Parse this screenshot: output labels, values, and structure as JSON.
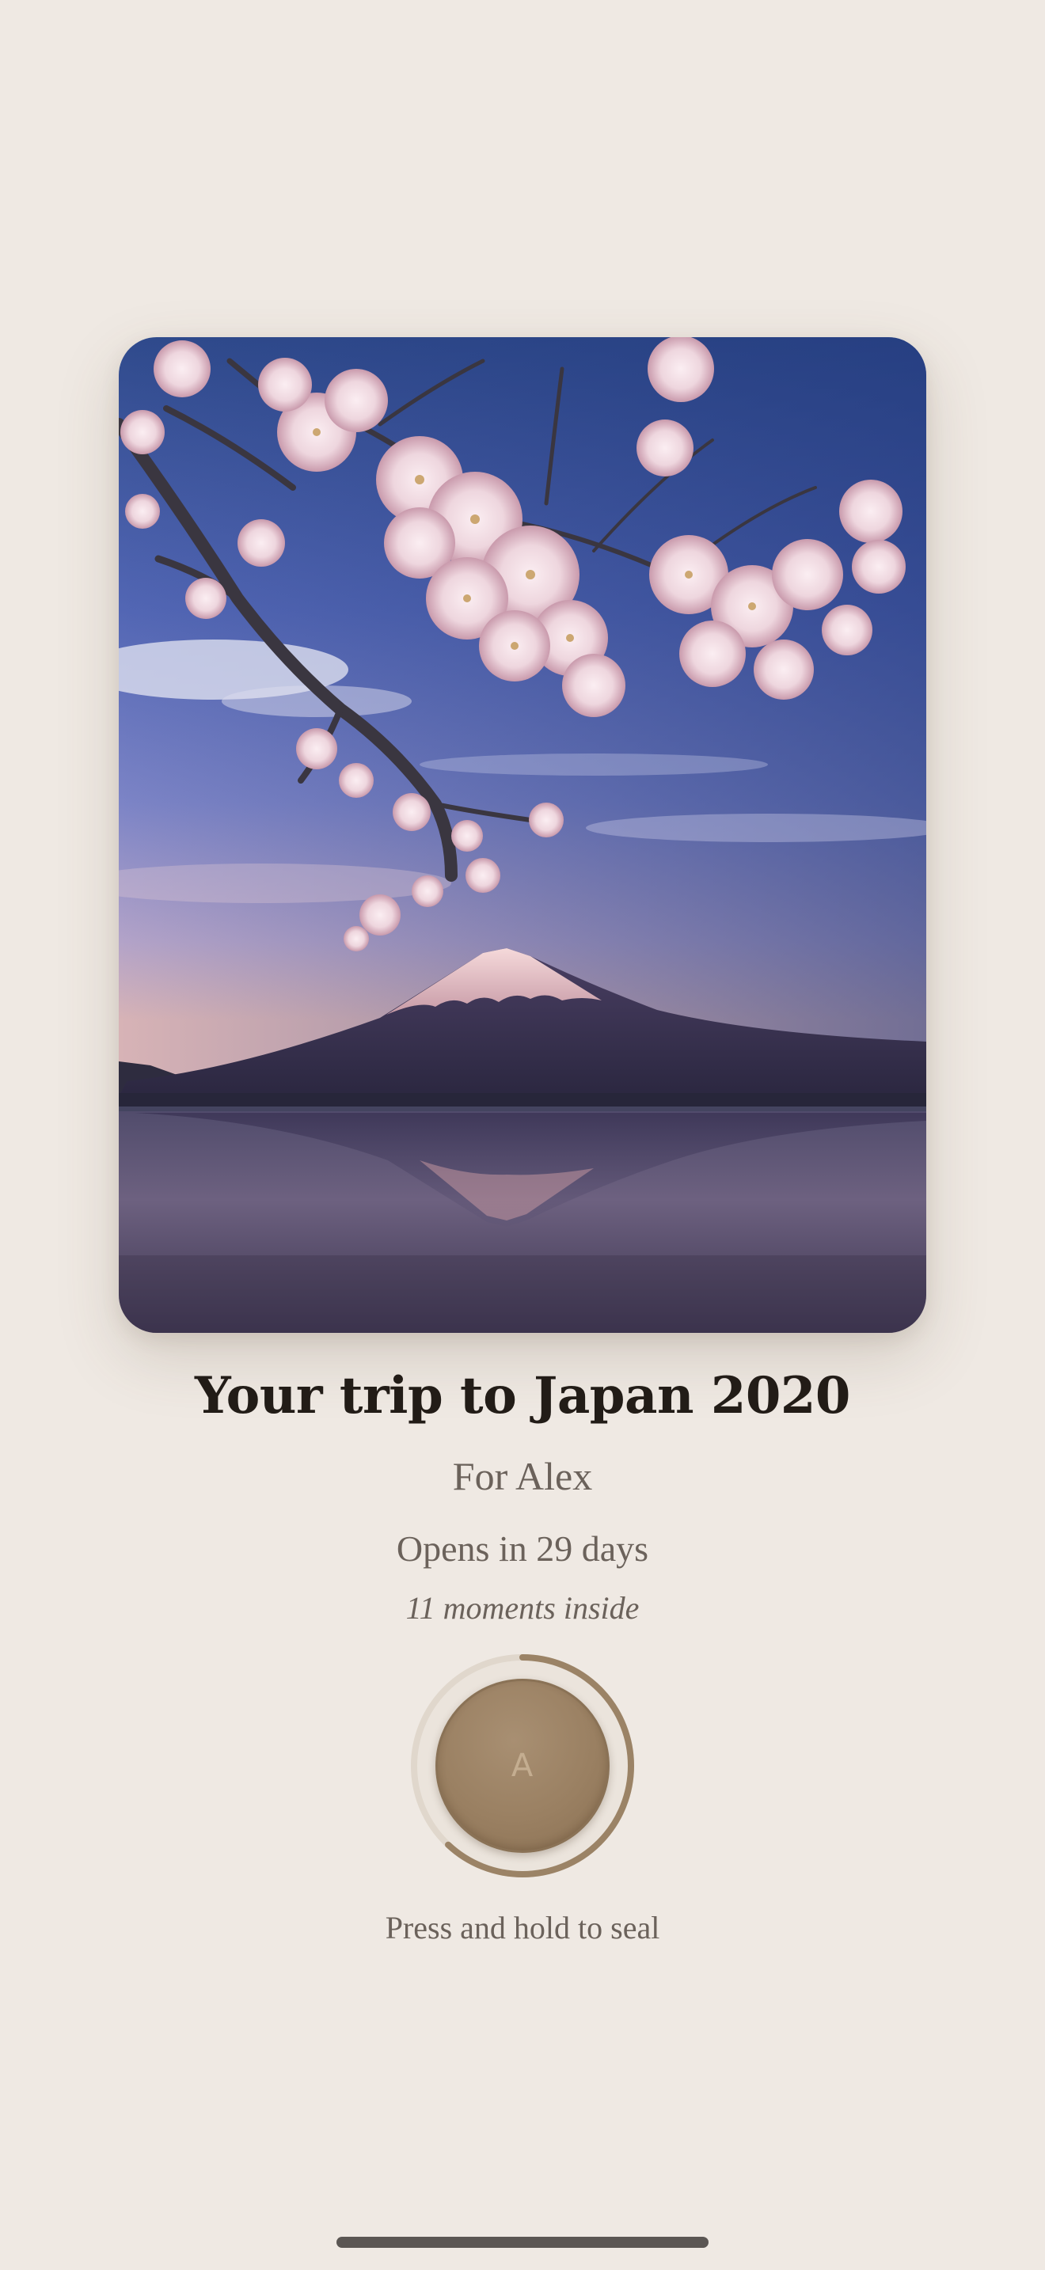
{
  "capsule": {
    "title": "Your trip to Japan 2020",
    "recipient": "For Alex",
    "countdown": "Opens in 29 days",
    "moments": "11 moments inside",
    "seal_initial": "A",
    "seal_hint": "Press and hold to seal",
    "hold_progress": 0.62
  },
  "photo": {
    "subject": "mount-fuji-cherry-blossoms-photo"
  },
  "colors": {
    "background": "#efe9e3",
    "title": "#221c17",
    "secondary_text": "#6b625b",
    "seal_gold": "#9a8062",
    "progress_ring": "#9b8366",
    "ring_track": "#e3dbd1"
  },
  "system": {
    "home_indicator": "home-indicator"
  }
}
